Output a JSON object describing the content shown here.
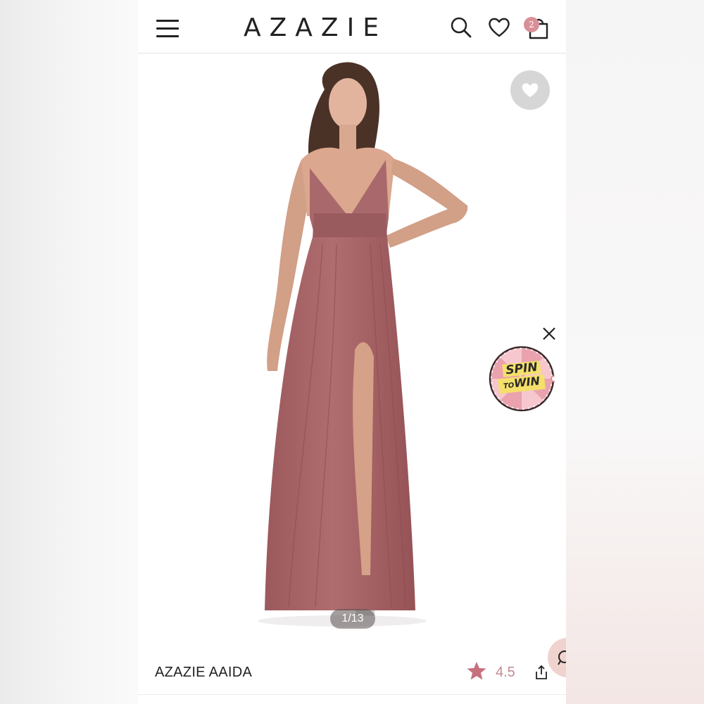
{
  "header": {
    "brand": "AZAZIE",
    "cart_count": "2"
  },
  "gallery": {
    "counter": "1/13",
    "promo_line1": "SPIN",
    "promo_line2_small": "TO",
    "promo_line2": "WIN"
  },
  "product": {
    "title": "AZAZIE AAIDA",
    "rating": "4.5"
  },
  "colors": {
    "accent": "#d98f97",
    "rating": "#c48991",
    "dress": "#a86467",
    "favorite_bg": "#d6d6d6"
  },
  "icons": [
    "menu-icon",
    "search-icon",
    "heart-icon",
    "bag-icon",
    "favorite-heart-icon",
    "close-icon",
    "star-icon",
    "share-icon",
    "chat-icon"
  ]
}
